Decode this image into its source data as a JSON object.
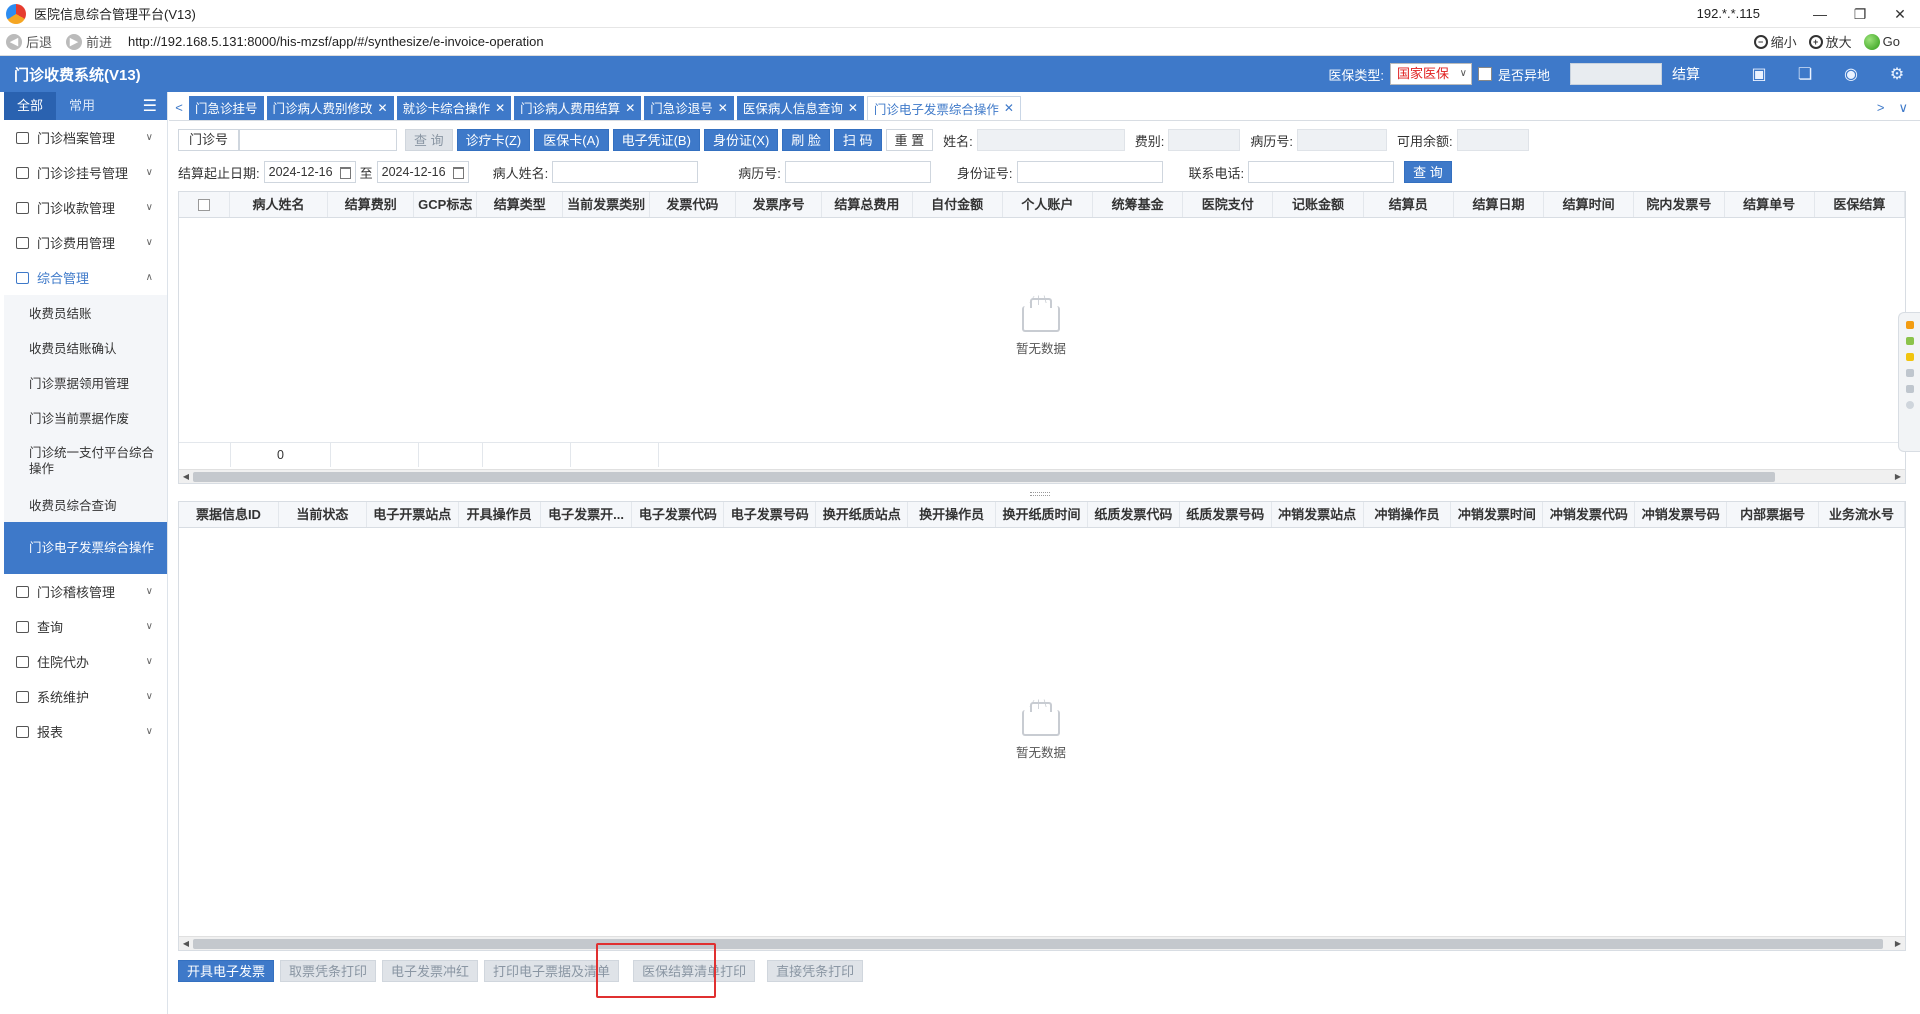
{
  "window": {
    "title": "医院信息综合管理平台(V13)",
    "ip": "192.*.*.115",
    "minimize": "—",
    "restore": "❐",
    "close": "✕"
  },
  "addressbar": {
    "back": "后退",
    "forward": "前进",
    "url": "http://192.168.5.131:8000/his-mzsf/app/#/synthesize/e-invoice-operation",
    "zoom_out": "缩小",
    "zoom_in": "放大",
    "go": "Go"
  },
  "header": {
    "app_title": "门诊收费系统(V13)",
    "insurance_type_label": "医保类型:",
    "insurance_type_value": "国家医保",
    "remote_label": "是否异地",
    "settle_label": "结算"
  },
  "sidebar": {
    "tab_all": "全部",
    "tab_common": "常用",
    "items": [
      {
        "label": "门诊档案管理"
      },
      {
        "label": "门诊诊挂号管理"
      },
      {
        "label": "门诊收款管理"
      },
      {
        "label": "门诊费用管理"
      },
      {
        "label": "综合管理"
      },
      {
        "label": "门诊稽核管理"
      },
      {
        "label": "查询"
      },
      {
        "label": "住院代办"
      },
      {
        "label": "系统维护"
      },
      {
        "label": "报表"
      }
    ],
    "sub_items": [
      {
        "label": "收费员结账"
      },
      {
        "label": "收费员结账确认"
      },
      {
        "label": "门诊票据领用管理"
      },
      {
        "label": "门诊当前票据作废"
      },
      {
        "label": "门诊统一支付平台综合操作"
      },
      {
        "label": "收费员综合查询"
      },
      {
        "label": "门诊电子发票综合操作"
      }
    ]
  },
  "tabs": [
    {
      "label": "门急诊挂号",
      "closable": false
    },
    {
      "label": "门诊病人费别修改",
      "closable": true
    },
    {
      "label": "就诊卡综合操作",
      "closable": true
    },
    {
      "label": "门诊病人费用结算",
      "closable": true
    },
    {
      "label": "门急诊退号",
      "closable": true
    },
    {
      "label": "医保病人信息查询",
      "closable": true
    },
    {
      "label": "门诊电子发票综合操作",
      "closable": true,
      "active": true
    }
  ],
  "toolbar": {
    "outpatient_no_label": "门诊号",
    "query_btn": "查 询",
    "card_btn": "诊疗卡(Z)",
    "insurance_card_btn": "医保卡(A)",
    "e_voucher_btn": "电子凭证(B)",
    "id_card_btn": "身份证(X)",
    "face_btn": "刷 脸",
    "scan_btn": "扫 码",
    "reset_btn": "重 置",
    "name_label": "姓名:",
    "fee_type_label": "费别:",
    "record_no_label": "病历号:",
    "balance_label": "可用余额:"
  },
  "row2": {
    "date_range_label": "结算起止日期:",
    "date_start": "2024-12-16",
    "to_label": "至",
    "date_end": "2024-12-16",
    "patient_name_label": "病人姓名:",
    "record_no_label": "病历号:",
    "id_no_label": "身份证号:",
    "phone_label": "联系电话:",
    "query_btn": "查 询"
  },
  "grid1": {
    "columns": [
      "病人姓名",
      "结算费别",
      "GCP标志",
      "结算类型",
      "当前发票类别",
      "发票代码",
      "发票序号",
      "结算总费用",
      "自付金额",
      "个人账户",
      "统筹基金",
      "医院支付",
      "记账金额",
      "结算员",
      "结算日期",
      "结算时间",
      "院内发票号",
      "结算单号",
      "医保结算"
    ],
    "empty_text": "暂无数据",
    "footer_total": "0"
  },
  "grid2": {
    "columns": [
      "票据信息ID",
      "当前状态",
      "电子开票站点",
      "开具操作员",
      "电子发票开...",
      "电子发票代码",
      "电子发票号码",
      "换开纸质站点",
      "换开操作员",
      "换开纸质时间",
      "纸质发票代码",
      "纸质发票号码",
      "冲销发票站点",
      "冲销操作员",
      "冲销发票时间",
      "冲销发票代码",
      "冲销发票号码",
      "内部票据号",
      "业务流水号"
    ],
    "empty_text": "暂无数据"
  },
  "bottom_buttons": {
    "issue": "开具电子发票",
    "voucher_print": "取票凭条打印",
    "red": "电子发票冲红",
    "print_ticket": "打印电子票据及清单",
    "insurance_print": "医保结算清单打印",
    "direct_print": "直接凭条打印"
  },
  "colors": {
    "primary": "#3e79c9",
    "header": "#3e79c9",
    "danger": "#e02020"
  }
}
